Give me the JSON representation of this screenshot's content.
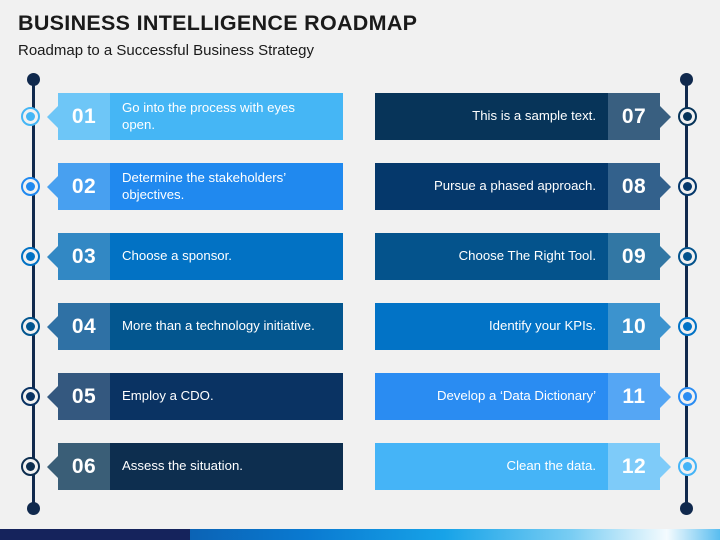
{
  "header": {
    "title": "BUSINESS INTELLIGENCE ROADMAP",
    "subtitle": "Roadmap to a Successful Business Strategy"
  },
  "palette": {
    "background": "#f1f1f1",
    "axis": "#10294d",
    "footer_solid": "#15235c"
  },
  "roadmap": {
    "left_column": [
      {
        "number": "01",
        "label": "Go into the process with eyes open.",
        "bar_color": "#45b6f5",
        "num_color": "#6ec6f7"
      },
      {
        "number": "02",
        "label": "Determine the stakeholders’ objectives.",
        "bar_color": "#2089ef",
        "num_color": "#48a0f0"
      },
      {
        "number": "03",
        "label": "Choose a sponsor.",
        "bar_color": "#0272c4",
        "num_color": "#3288c4"
      },
      {
        "number": "04",
        "label": "More than a technology initiative.",
        "bar_color": "#03568f",
        "num_color": "#2f71a5"
      },
      {
        "number": "05",
        "label": "Employ a CDO.",
        "bar_color": "#0a3363",
        "num_color": "#34587f"
      },
      {
        "number": "06",
        "label": "Assess the situation.",
        "bar_color": "#0d2e4f",
        "num_color": "#3a5e77"
      }
    ],
    "right_column": [
      {
        "number": "07",
        "label": "This is a sample text.",
        "bar_color": "#073459",
        "num_color": "#395f80"
      },
      {
        "number": "08",
        "label": "Pursue a phased approach.",
        "bar_color": "#05386b",
        "num_color": "#33618c"
      },
      {
        "number": "09",
        "label": "Choose The Right Tool.",
        "bar_color": "#04538c",
        "num_color": "#3277a4"
      },
      {
        "number": "10",
        "label": "Identify your KPIs.",
        "bar_color": "#0273c6",
        "num_color": "#3c93ce"
      },
      {
        "number": "11",
        "label": "Develop a ‘Data Dictionary’",
        "bar_color": "#2a8cf2",
        "num_color": "#55a6f4"
      },
      {
        "number": "12",
        "label": "Clean the data.",
        "bar_color": "#45b4f7",
        "num_color": "#7ecbf9"
      }
    ]
  }
}
